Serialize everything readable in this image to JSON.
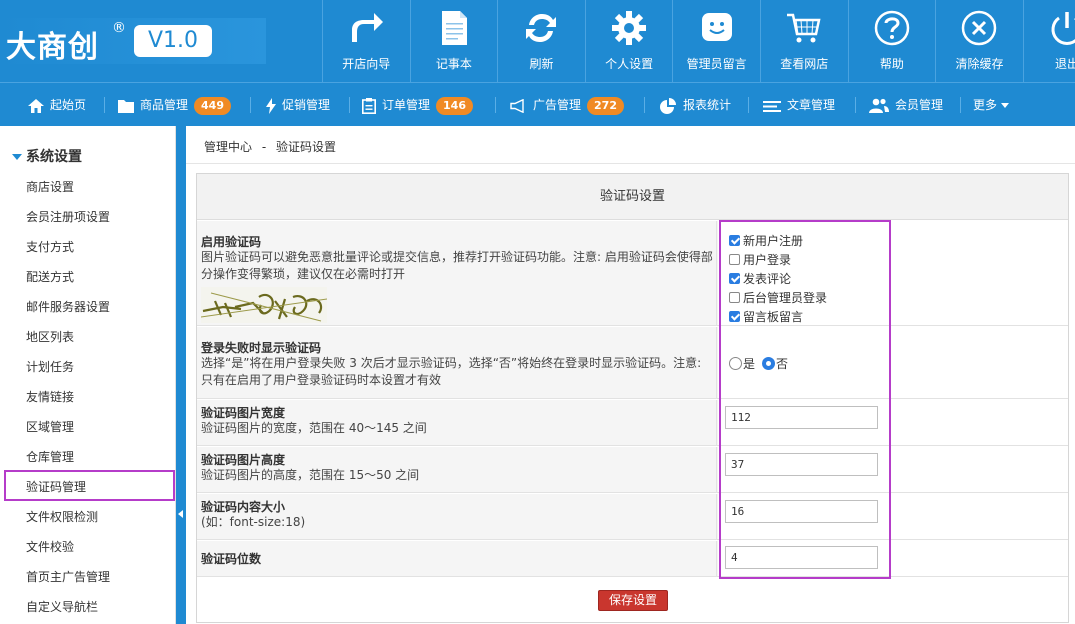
{
  "header": {
    "logo": "大商创",
    "logo_reg": "®",
    "version": "V1.0",
    "items": [
      {
        "label": "开店向导",
        "icon": "share-arrow-icon"
      },
      {
        "label": "记事本",
        "icon": "notepad-icon"
      },
      {
        "label": "刷新",
        "icon": "refresh-icon"
      },
      {
        "label": "个人设置",
        "icon": "gear-icon"
      },
      {
        "label": "管理员留言",
        "icon": "smiley-chat-icon"
      },
      {
        "label": "查看网店",
        "icon": "cart-icon"
      },
      {
        "label": "帮助",
        "icon": "question-icon"
      },
      {
        "label": "清除缓存",
        "icon": "close-circle-icon"
      },
      {
        "label": "退出",
        "icon": "power-icon"
      }
    ]
  },
  "nav": {
    "items": [
      {
        "label": "起始页",
        "icon": "home-icon"
      },
      {
        "label": "商品管理",
        "icon": "folder-icon",
        "badge": "449"
      },
      {
        "label": "促销管理",
        "icon": "bolt-icon"
      },
      {
        "label": "订单管理",
        "icon": "clipboard-icon",
        "badge": "146"
      },
      {
        "label": "广告管理",
        "icon": "megaphone-icon",
        "badge": "272"
      },
      {
        "label": "报表统计",
        "icon": "pie-chart-icon"
      },
      {
        "label": "文章管理",
        "icon": "list-icon"
      },
      {
        "label": "会员管理",
        "icon": "users-icon"
      },
      {
        "label": "更多"
      }
    ]
  },
  "sidebar": {
    "section": "系统设置",
    "items": [
      "商店设置",
      "会员注册项设置",
      "支付方式",
      "配送方式",
      "邮件服务器设置",
      "地区列表",
      "计划任务",
      "友情链接",
      "区域管理",
      "仓库管理",
      "验证码管理",
      "文件权限检测",
      "文件校验",
      "首页主广告管理",
      "自定义导航栏"
    ],
    "active_index": 10
  },
  "breadcrumb": {
    "root": "管理中心",
    "sep": "-",
    "current": "验证码设置"
  },
  "panel": {
    "title": "验证码设置",
    "enable": {
      "label": "启用验证码",
      "desc": "图片验证码可以避免恶意批量评论或提交信息，推荐打开验证码功能。注意: 启用验证码会使得部分操作变得繁琐，建议仅在必需时打开",
      "options": [
        {
          "label": "新用户注册",
          "checked": true
        },
        {
          "label": "用户登录",
          "checked": false
        },
        {
          "label": "发表评论",
          "checked": true
        },
        {
          "label": "后台管理员登录",
          "checked": false
        },
        {
          "label": "留言板留言",
          "checked": true
        }
      ]
    },
    "login_fail": {
      "label": "登录失败时显示验证码",
      "desc": "选择“是”将在用户登录失败 3 次后才显示验证码，选择“否”将始终在登录时显示验证码。注意: 只有在启用了用户登录验证码时本设置才有效",
      "yes": "是",
      "no": "否",
      "selected": "否"
    },
    "width": {
      "label": "验证码图片宽度",
      "desc": "验证码图片的宽度，范围在 40～145 之间",
      "value": "112"
    },
    "height": {
      "label": "验证码图片高度",
      "desc": "验证码图片的高度，范围在 15～50 之间",
      "value": "37"
    },
    "font_size": {
      "label": "验证码内容大小",
      "desc": "(如：font-size:18)",
      "value": "16"
    },
    "digits": {
      "label": "验证码位数",
      "value": "4"
    },
    "save": "保存设置"
  }
}
